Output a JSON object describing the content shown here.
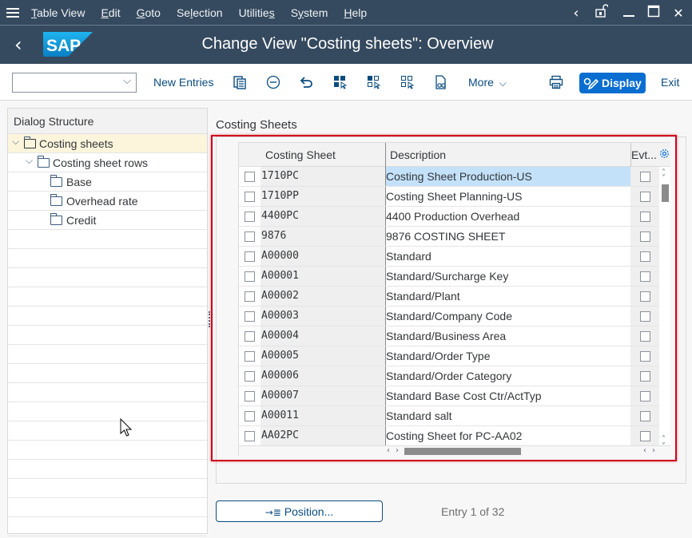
{
  "menubar": {
    "items": [
      {
        "label": "Table View",
        "mnemonic": "T"
      },
      {
        "label": "Edit",
        "mnemonic": "E"
      },
      {
        "label": "Goto",
        "mnemonic": "G"
      },
      {
        "label": "Selection",
        "mnemonic": "l"
      },
      {
        "label": "Utilities",
        "mnemonic": "s"
      },
      {
        "label": "System",
        "mnemonic": "y"
      },
      {
        "label": "Help",
        "mnemonic": "H"
      }
    ],
    "menu_icon": "hamburger-menu-icon",
    "window_controls": {
      "collapse": "‹",
      "lock_icon": "unlock-icon",
      "minimize": "minimize-icon",
      "maximize": "maximize-icon",
      "close": "✕"
    }
  },
  "header": {
    "title": "Change View \"Costing sheets\": Overview",
    "logo_text": "SAP",
    "back_icon": "back-icon"
  },
  "toolbar": {
    "command_field_value": "",
    "command_field_placeholder": "",
    "new_entries_label": "New Entries",
    "icons": [
      "copy-as-icon",
      "delete-icon",
      "undo-icon",
      "select-all-icon",
      "select-block-icon",
      "deselect-all-icon",
      "where-used-icon"
    ],
    "more_label": "More",
    "print_icon": "print-icon",
    "display_label": "Display",
    "exit_label": "Exit"
  },
  "dialog_structure": {
    "title": "Dialog Structure",
    "items": [
      {
        "label": "Costing sheets",
        "level": 0,
        "expanded": true,
        "selected": true
      },
      {
        "label": "Costing sheet rows",
        "level": 1,
        "expanded": true,
        "selected": false
      },
      {
        "label": "Base",
        "level": 2,
        "selected": false
      },
      {
        "label": "Overhead rate",
        "level": 2,
        "selected": false
      },
      {
        "label": "Credit",
        "level": 2,
        "selected": false
      }
    ]
  },
  "main": {
    "section_title": "Costing Sheets",
    "table": {
      "columns": [
        "Costing Sheet",
        "Description",
        "Evt..."
      ],
      "rows": [
        {
          "sheet": "1710PC",
          "description": "Costing Sheet Production-US",
          "evt": false,
          "active": true
        },
        {
          "sheet": "1710PP",
          "description": "Costing Sheet Planning-US",
          "evt": false
        },
        {
          "sheet": "4400PC",
          "description": "4400 Production Overhead",
          "evt": false
        },
        {
          "sheet": "9876",
          "description": "9876 COSTING SHEET",
          "evt": false
        },
        {
          "sheet": "A00000",
          "description": "Standard",
          "evt": false
        },
        {
          "sheet": "A00001",
          "description": "Standard/Surcharge Key",
          "evt": false
        },
        {
          "sheet": "A00002",
          "description": "Standard/Plant",
          "evt": false
        },
        {
          "sheet": "A00003",
          "description": "Standard/Company Code",
          "evt": false
        },
        {
          "sheet": "A00004",
          "description": "Standard/Business Area",
          "evt": false
        },
        {
          "sheet": "A00005",
          "description": "Standard/Order Type",
          "evt": false
        },
        {
          "sheet": "A00006",
          "description": "Standard/Order Category",
          "evt": false
        },
        {
          "sheet": "A00007",
          "description": "Standard Base Cost Ctr/ActTyp",
          "evt": false
        },
        {
          "sheet": "A00011",
          "description": "Standard salt",
          "evt": false
        },
        {
          "sheet": "AA02PC",
          "description": "Costing Sheet for PC-AA02",
          "evt": false
        }
      ]
    },
    "position_button_label": "Position...",
    "entry_info": "Entry 1 of 32"
  },
  "colors": {
    "shell": "#354a5f",
    "accent": "#0a6ed1",
    "highlight_border": "#d0021b",
    "selected_tree_row": "#fcf5dc",
    "active_cell": "#c4e1fa"
  }
}
